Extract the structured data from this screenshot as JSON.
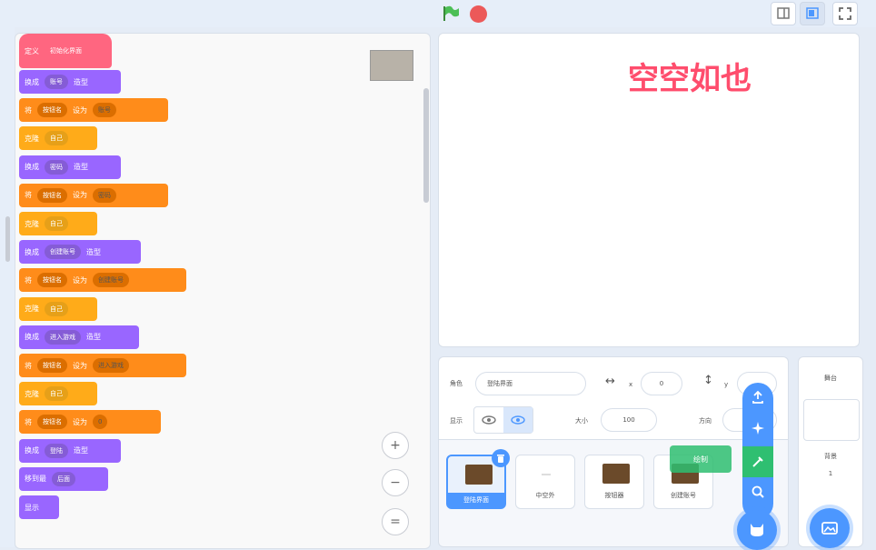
{
  "code": {
    "blocks": [
      {
        "kind": "ev",
        "label": "定义",
        "pill": "初始化界面"
      },
      {
        "kind": "lk",
        "label": "换成",
        "pill": "账号",
        "tail": "造型"
      },
      {
        "kind": "vr",
        "label": "将",
        "pill": "按钮名",
        "mid": "设为",
        "val": "账号"
      },
      {
        "kind": "ct",
        "label": "克隆",
        "pill": "自己"
      },
      {
        "kind": "lk",
        "label": "换成",
        "pill": "密码",
        "tail": "造型"
      },
      {
        "kind": "vr",
        "label": "将",
        "pill": "按钮名",
        "mid": "设为",
        "val": "密码"
      },
      {
        "kind": "ct",
        "label": "克隆",
        "pill": "自己"
      },
      {
        "kind": "lk",
        "label": "换成",
        "pill": "创建账号",
        "tail": "造型"
      },
      {
        "kind": "vr",
        "label": "将",
        "pill": "按钮名",
        "mid": "设为",
        "val": "创建账号"
      },
      {
        "kind": "ct",
        "label": "克隆",
        "pill": "自己"
      },
      {
        "kind": "lk",
        "label": "换成",
        "pill": "进入游戏",
        "tail": "造型"
      },
      {
        "kind": "vr",
        "label": "将",
        "pill": "按钮名",
        "mid": "设为",
        "val": "进入游戏"
      },
      {
        "kind": "ct",
        "label": "克隆",
        "pill": "自己"
      },
      {
        "kind": "vr",
        "label": "将",
        "pill": "按钮名",
        "mid": "设为",
        "val": "0"
      },
      {
        "kind": "lk",
        "label": "换成",
        "pill": "登陆",
        "tail": "造型"
      },
      {
        "kind": "lk",
        "label": "移到最",
        "pill": "后面"
      },
      {
        "kind": "lk",
        "label": "显示"
      }
    ]
  },
  "stage": {
    "text": "空空如也"
  },
  "sprite_info": {
    "sprite_label": "角色",
    "sprite_name": "登陆界面",
    "x_label": "x",
    "x_value": "0",
    "y_label": "y",
    "show_label": "显示",
    "size_label": "大小",
    "size_value": "100",
    "direction_label": "方向"
  },
  "sprites": [
    {
      "name": "登陆界面",
      "selected": true
    },
    {
      "name": "中空外",
      "selected": false
    },
    {
      "name": "按钮器",
      "selected": false
    },
    {
      "name": "创建账号",
      "selected": false
    }
  ],
  "add_menu": {
    "tooltip": "绘制"
  },
  "stage_panel": {
    "title": "舞台",
    "backdrop_label": "背景",
    "backdrop_count": "1"
  },
  "zoom": {
    "in": "+",
    "out": "−",
    "reset": "="
  },
  "colors": {
    "events": "#ff6680",
    "looks": "#9966ff",
    "variables": "#ff8c1a",
    "control": "#ffab19",
    "accent": "#4c97ff",
    "stage_text": "#ff4d6d"
  }
}
